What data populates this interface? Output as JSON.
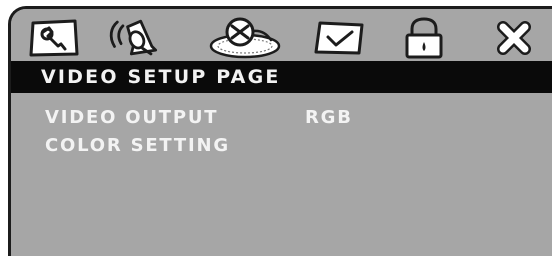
{
  "icons": [
    {
      "name": "general-setup-icon",
      "selected": false
    },
    {
      "name": "audio-setup-icon",
      "selected": false
    },
    {
      "name": "video-setup-icon",
      "selected": true
    },
    {
      "name": "preference-icon",
      "selected": false
    },
    {
      "name": "password-lock-icon",
      "selected": false
    },
    {
      "name": "exit-icon",
      "selected": false
    }
  ],
  "page_title": "VIDEO SETUP PAGE",
  "menu": {
    "items": [
      {
        "label": "VIDEO OUTPUT",
        "value": "RGB"
      },
      {
        "label": "COLOR SETTING",
        "value": ""
      }
    ]
  },
  "colors": {
    "panel": "#a6a6a6",
    "title_bar": "#0a0a0a",
    "text": "#f3f3f3",
    "outline": "#1c1c1c"
  }
}
